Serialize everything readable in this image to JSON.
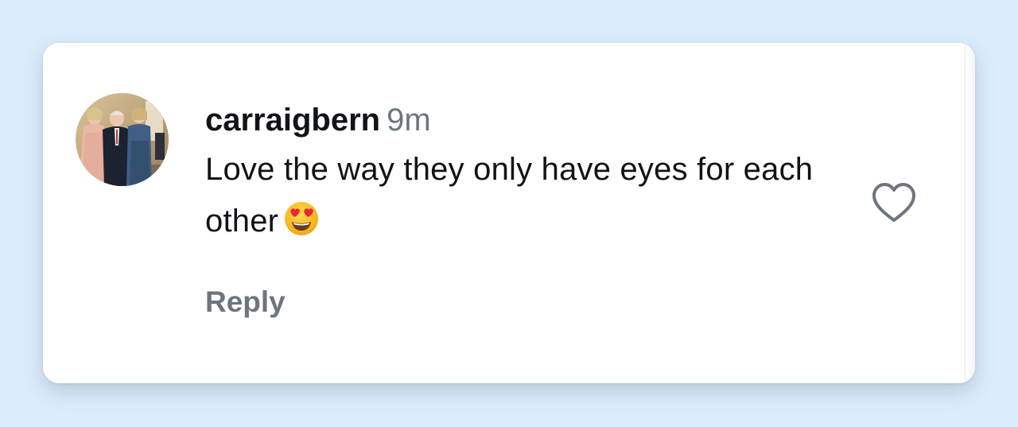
{
  "comment": {
    "username": "carraigbern",
    "timestamp": "9m",
    "text": "Love the way they only have eyes for each other",
    "emoji": "heart-eyes-emoji",
    "reply_label": "Reply"
  },
  "icons": {
    "like": "heart-outline-icon",
    "avatar": "user-avatar-photo"
  },
  "colors": {
    "page_background": "#dcecfb",
    "card_background": "#ffffff",
    "primary_text": "#111317",
    "secondary_text": "#6e757e"
  }
}
